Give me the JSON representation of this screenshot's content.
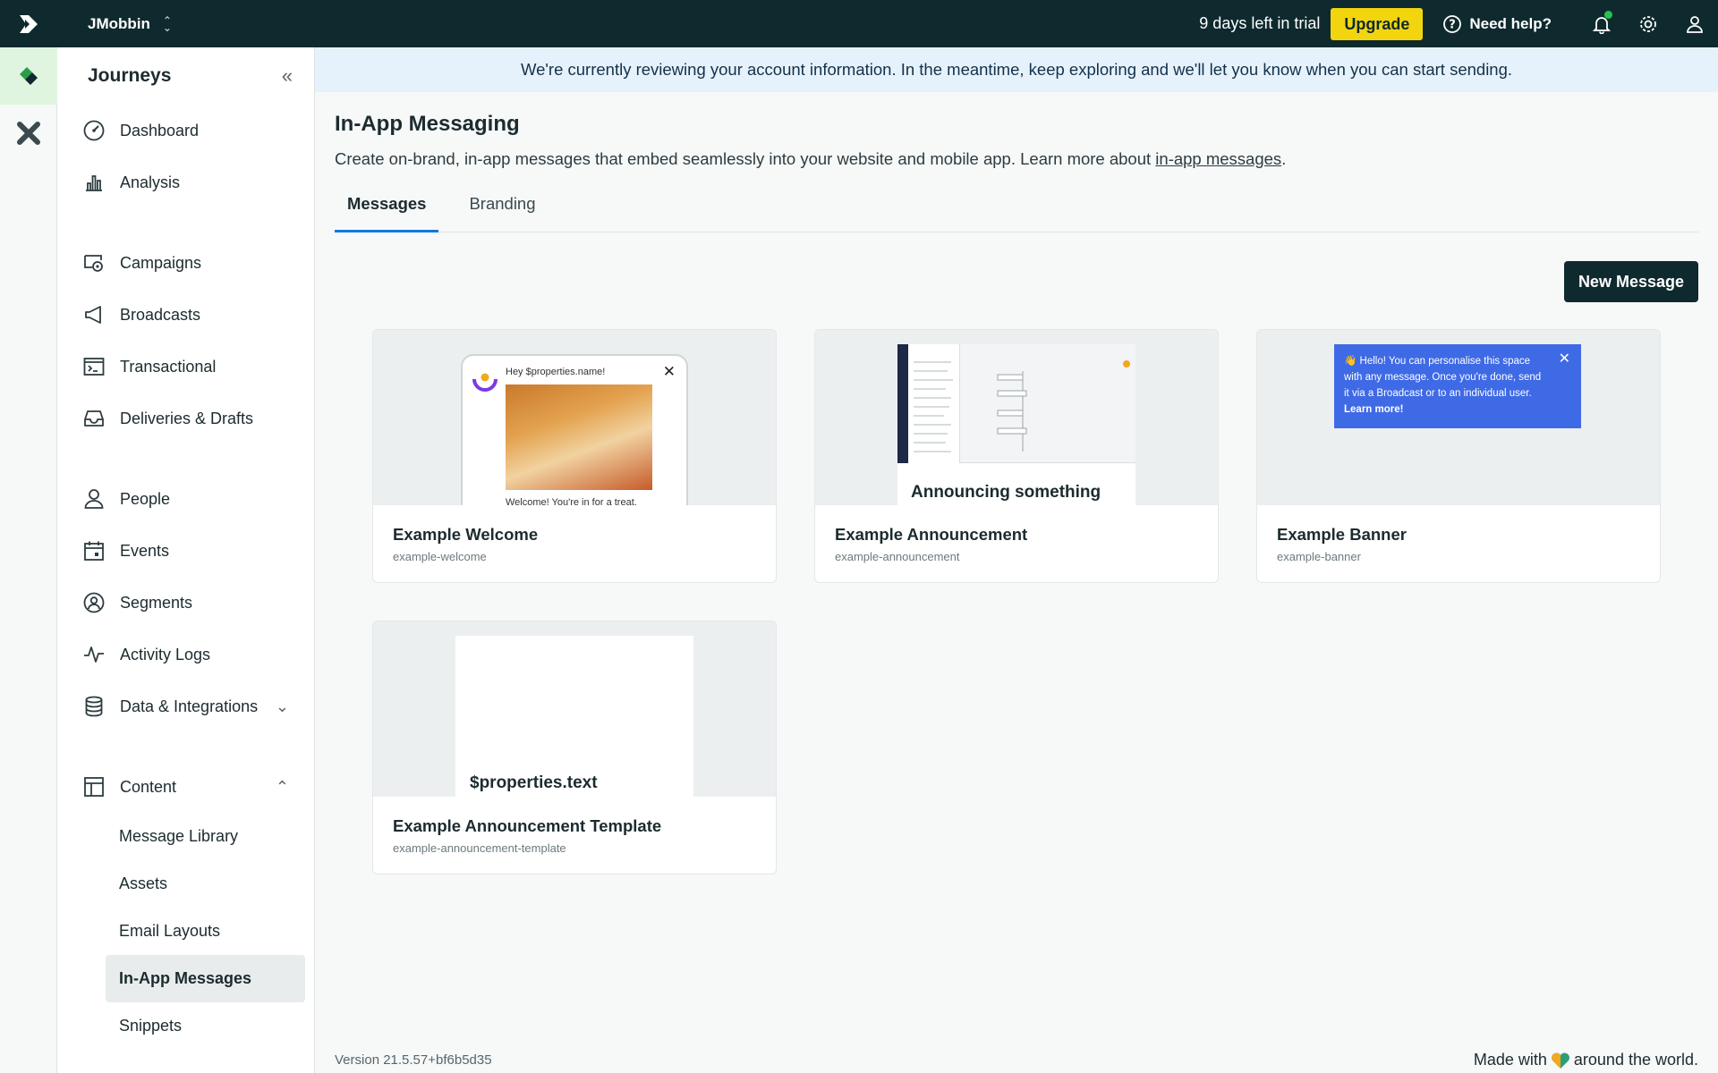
{
  "topbar": {
    "workspace": "JMobbin",
    "trial_text": "9 days left in trial",
    "upgrade_label": "Upgrade",
    "help_label": "Need help?"
  },
  "sidebar": {
    "title": "Journeys",
    "items": [
      {
        "label": "Dashboard",
        "icon": "gauge-icon"
      },
      {
        "label": "Analysis",
        "icon": "bar-chart-icon"
      },
      {
        "label": "Campaigns",
        "icon": "campaign-icon"
      },
      {
        "label": "Broadcasts",
        "icon": "megaphone-icon"
      },
      {
        "label": "Transactional",
        "icon": "terminal-icon"
      },
      {
        "label": "Deliveries & Drafts",
        "icon": "inbox-icon"
      },
      {
        "label": "People",
        "icon": "person-icon"
      },
      {
        "label": "Events",
        "icon": "calendar-icon"
      },
      {
        "label": "Segments",
        "icon": "segment-icon"
      },
      {
        "label": "Activity Logs",
        "icon": "pulse-icon"
      },
      {
        "label": "Data & Integrations",
        "icon": "database-icon"
      },
      {
        "label": "Content",
        "icon": "layout-icon"
      }
    ],
    "content_sub": [
      "Message Library",
      "Assets",
      "Email Layouts",
      "In-App Messages",
      "Snippets"
    ]
  },
  "notice": "We're currently reviewing your account information. In the meantime, keep exploring and we'll let you know when you can start sending.",
  "page": {
    "title": "In-App Messaging",
    "desc_prefix": "Create on-brand, in-app messages that embed seamlessly into your website and mobile app. Learn more about ",
    "desc_link": "in-app messages",
    "desc_suffix": ".",
    "tabs": [
      "Messages",
      "Branding"
    ],
    "new_button": "New Message"
  },
  "cards": [
    {
      "title": "Example Welcome",
      "slug": "example-welcome",
      "preview_top": "Hey $properties.name!",
      "preview_bottom": "Welcome! You're in for a treat."
    },
    {
      "title": "Example Announcement",
      "slug": "example-announcement",
      "preview_text": "Announcing something"
    },
    {
      "title": "Example Banner",
      "slug": "example-banner",
      "preview_text": "👋 Hello! You can personalise this space with any message. Once you're done, send it via a Broadcast or to an individual user. ",
      "preview_link": "Learn more!"
    },
    {
      "title": "Example Announcement Template",
      "slug": "example-announcement-template",
      "preview_text": "$properties.text"
    }
  ],
  "footer": {
    "version": "Version 21.5.57+bf6b5d35",
    "made_prefix": "Made with",
    "made_suffix": "around the world."
  },
  "colors": {
    "topbar": "#0f2a2e",
    "upgrade": "#f2d50f",
    "tab_active": "#0d7adf",
    "banner": "#3f6ae6"
  }
}
